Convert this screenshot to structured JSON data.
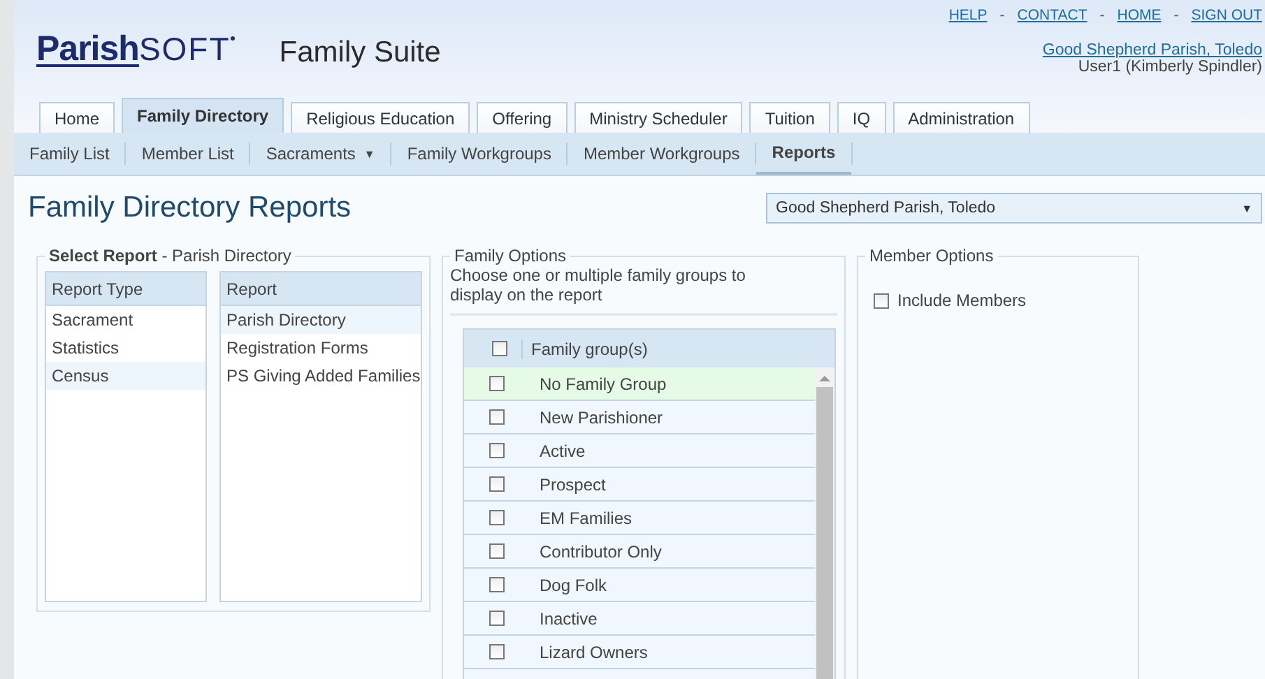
{
  "header": {
    "logo_main": "Parish",
    "logo_suffix": "SOFT",
    "suite": "Family Suite",
    "links": [
      "HELP",
      "CONTACT",
      "HOME",
      "SIGN OUT"
    ],
    "link_separator": "-",
    "parish_link": "Good Shepherd Parish, Toledo",
    "user": "User1 (Kimberly Spindler)"
  },
  "tabs": [
    {
      "label": "Home",
      "selected": false
    },
    {
      "label": "Family Directory",
      "selected": true
    },
    {
      "label": "Religious Education",
      "selected": false
    },
    {
      "label": "Offering",
      "selected": false
    },
    {
      "label": "Ministry Scheduler",
      "selected": false
    },
    {
      "label": "Tuition",
      "selected": false
    },
    {
      "label": "IQ",
      "selected": false
    },
    {
      "label": "Administration",
      "selected": false
    }
  ],
  "subnav": [
    {
      "label": "Family List",
      "selected": false
    },
    {
      "label": "Member List",
      "selected": false
    },
    {
      "label": "Sacraments",
      "caret": "▼",
      "selected": false
    },
    {
      "label": "Family Workgroups",
      "selected": false
    },
    {
      "label": "Member Workgroups",
      "selected": false
    },
    {
      "label": "Reports",
      "selected": true
    }
  ],
  "page_title": "Family Directory Reports",
  "parish_select": {
    "value": "Good Shepherd Parish, Toledo",
    "caret": "▼"
  },
  "select_report": {
    "legend": "Select Report",
    "separator": "-",
    "current": "Parish Directory",
    "report_types": {
      "heading": "Report Type",
      "items": [
        {
          "label": "Sacrament",
          "selected": false
        },
        {
          "label": "Statistics",
          "selected": false
        },
        {
          "label": "Census",
          "selected": true
        }
      ]
    },
    "reports": {
      "heading": "Report",
      "items": [
        {
          "label": "Parish Directory",
          "selected": true
        },
        {
          "label": "Registration Forms",
          "selected": false
        },
        {
          "label": "PS Giving Added Families",
          "selected": false
        }
      ]
    }
  },
  "family_options": {
    "legend": "Family Options",
    "hint": "Choose one or multiple family groups to display on the report",
    "header": {
      "label": "Family group(s)",
      "checked": false
    },
    "groups": [
      {
        "label": "No Family Group",
        "checked": false,
        "highlighted": true
      },
      {
        "label": "New Parishioner",
        "checked": false,
        "highlighted": false
      },
      {
        "label": "Active",
        "checked": false,
        "highlighted": false
      },
      {
        "label": "Prospect",
        "checked": false,
        "highlighted": false
      },
      {
        "label": "EM Families",
        "checked": false,
        "highlighted": false
      },
      {
        "label": "Contributor Only",
        "checked": false,
        "highlighted": false
      },
      {
        "label": "Dog Folk",
        "checked": false,
        "highlighted": false
      },
      {
        "label": "Inactive",
        "checked": false,
        "highlighted": false
      },
      {
        "label": "Lizard Owners",
        "checked": false,
        "highlighted": false
      }
    ]
  },
  "member_options": {
    "legend": "Member Options",
    "include_members": {
      "label": "Include Members",
      "checked": false
    }
  }
}
